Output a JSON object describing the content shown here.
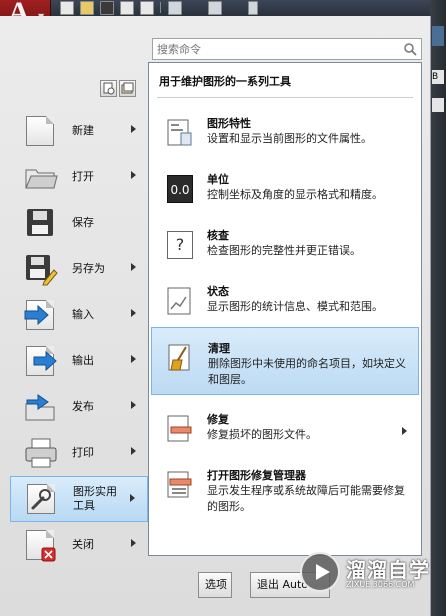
{
  "app": {
    "logo_letter": "A"
  },
  "search": {
    "placeholder": "搜索命令"
  },
  "left_menu": [
    {
      "id": "new",
      "label": "新建",
      "has_submenu": true
    },
    {
      "id": "open",
      "label": "打开",
      "has_submenu": true
    },
    {
      "id": "save",
      "label": "保存",
      "has_submenu": false
    },
    {
      "id": "saveas",
      "label": "另存为",
      "has_submenu": true
    },
    {
      "id": "import",
      "label": "输入",
      "has_submenu": true
    },
    {
      "id": "export",
      "label": "输出",
      "has_submenu": true
    },
    {
      "id": "publish",
      "label": "发布",
      "has_submenu": true
    },
    {
      "id": "print",
      "label": "打印",
      "has_submenu": true
    },
    {
      "id": "utilities",
      "label": "图形实用\n工具",
      "has_submenu": true,
      "active": true
    },
    {
      "id": "close",
      "label": "关闭",
      "has_submenu": true
    }
  ],
  "panel": {
    "title": "用于维护图形的一系列工具",
    "items": [
      {
        "title": "图形特性",
        "desc": "设置和显示当前图形的文件属性。",
        "icon": "drawing-properties-icon"
      },
      {
        "title": "单位",
        "desc": "控制坐标及角度的显示格式和精度。",
        "icon": "units-icon",
        "icon_text": "0.0"
      },
      {
        "title": "核查",
        "desc": "检查图形的完整性并更正错误。",
        "icon": "audit-icon",
        "icon_text": "?"
      },
      {
        "title": "状态",
        "desc": "显示图形的统计信息、模式和范围。",
        "icon": "status-icon"
      },
      {
        "title": "清理",
        "desc": "删除图形中未使用的命名项目，如块定义和图层。",
        "icon": "purge-icon",
        "selected": true
      },
      {
        "title": "修复",
        "desc": "修复损坏的图形文件。",
        "icon": "recover-icon",
        "has_submenu": true
      },
      {
        "title": "打开图形修复管理器",
        "desc": "显示发生程序或系统故障后可能需要修复的图形。",
        "icon": "recovery-manager-icon"
      }
    ]
  },
  "buttons": {
    "options": "选项",
    "exit": "退出 Auto"
  },
  "watermark": {
    "title": "溜溜自学",
    "subtitle": "ZIXUE.3066.COM"
  },
  "background_edge": {
    "text_b": "B"
  },
  "colors": {
    "app_button": "#a02020",
    "selection": "#bcdaf3",
    "selection_border": "#7eb4ea"
  }
}
